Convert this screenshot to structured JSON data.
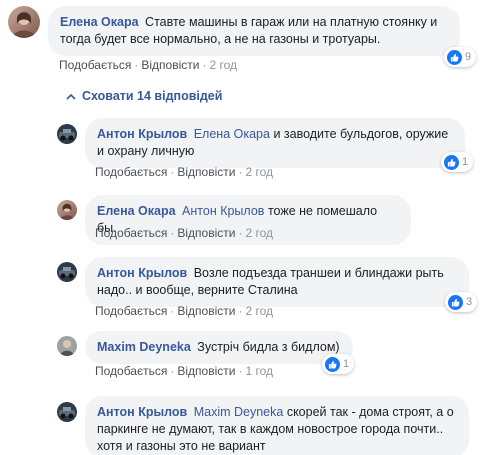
{
  "icons": {
    "like": "like-icon",
    "collapse": "chevron-up-icon"
  },
  "actions": {
    "like": "Подобається",
    "reply": "Відповісти",
    "sep": "·"
  },
  "top_comment": {
    "author": "Елена Окара",
    "text": "Ставте машины в гараж или на платную стоянку и тогда будет все нормально, а не на газоны и тротуары.",
    "time": "2 год",
    "likes": "9"
  },
  "hide_replies": "Сховати 14 відповідей",
  "replies": [
    {
      "author": "Антон Крылов",
      "mention": "Елена Окара",
      "text": "и заводите бульдогов, оружие и охрану личную",
      "time": "2 год",
      "likes": "1"
    },
    {
      "author": "Елена Окара",
      "mention": "Антон Крылов",
      "text": "тоже не помешало бы.",
      "time": "2 год",
      "likes": ""
    },
    {
      "author": "Антон Крылов",
      "mention": "",
      "text": "Возле подъезда траншеи и блиндажи рыть надо.. и вообще, верните Сталина",
      "time": "2 год",
      "likes": "3"
    },
    {
      "author": "Maxim Deyneka",
      "mention": "",
      "text": "Зустріч бидла з бидлом)",
      "time": "1 год",
      "likes": "1"
    },
    {
      "author": "Антон Крылов",
      "mention": "Maxim Deyneka",
      "text": "скорей так - дома строят, а о паркинге не думают, так в каждом новострое города почти.. хотя и газоны это не вариант",
      "time": "",
      "likes": ""
    }
  ]
}
